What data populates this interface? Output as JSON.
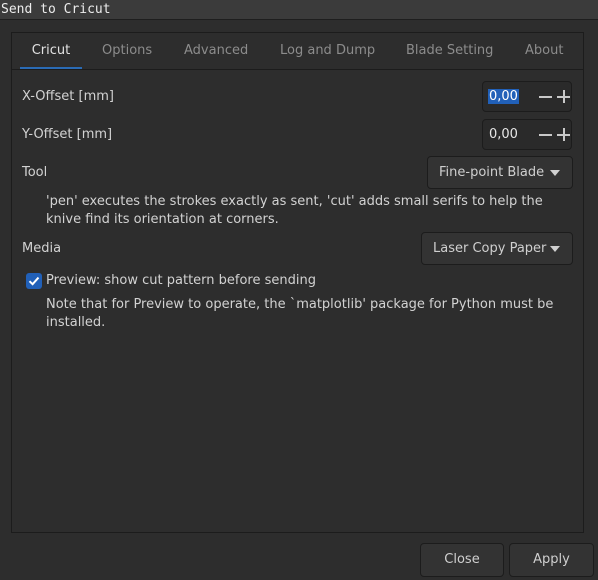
{
  "window": {
    "title": "Send to Cricut"
  },
  "tabs": [
    {
      "label": "Cricut",
      "active": true
    },
    {
      "label": "Options"
    },
    {
      "label": "Advanced"
    },
    {
      "label": "Log and Dump"
    },
    {
      "label": "Blade Setting"
    },
    {
      "label": "About"
    }
  ],
  "x_offset": {
    "label": "X-Offset [mm]",
    "value": "0,00"
  },
  "y_offset": {
    "label": "Y-Offset [mm]",
    "value": "0,00"
  },
  "tool": {
    "label": "Tool",
    "selected": "Fine-point Blade",
    "description": "'pen' executes the strokes exactly as sent, 'cut' adds small serifs to help the knive find its orientation at corners."
  },
  "media": {
    "label": "Media",
    "selected": "Laser Copy Paper"
  },
  "preview": {
    "label": "Preview: show cut pattern before sending",
    "checked": true,
    "note": "Note that for Preview to operate, the `matplotlib' package for Python must be installed."
  },
  "footer": {
    "close_label": "Close",
    "apply_label": "Apply"
  },
  "colors": {
    "accent": "#2160b8",
    "background": "#2d2d2d"
  },
  "icons": {
    "spin_decrement": "minus-icon",
    "spin_increment": "plus-icon",
    "combo_arrow": "chevron-down-icon",
    "checkbox": "checkmark-icon"
  }
}
